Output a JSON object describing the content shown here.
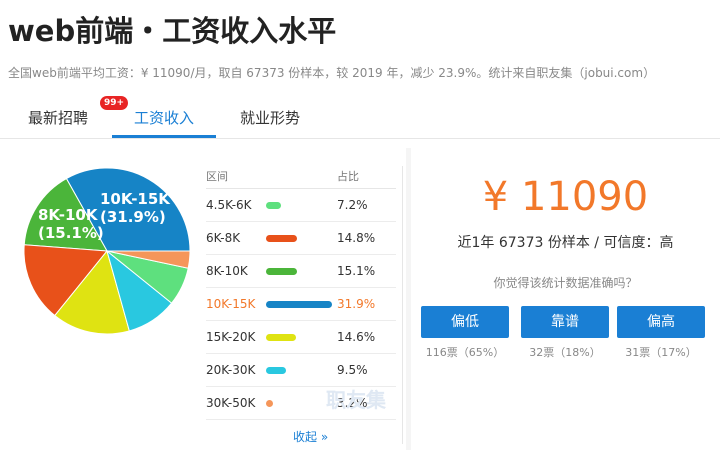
{
  "page": {
    "title": "web前端・工资收入水平",
    "subtitle": "全国web前端平均工资：¥ 11090/月，取自 67373 份样本，较 2019 年，减少 23.9%。统计来自职友集（jobui.com）"
  },
  "tabs": [
    {
      "label": "最新招聘",
      "badge": "99+"
    },
    {
      "label": "工资收入"
    },
    {
      "label": "就业形势"
    }
  ],
  "table": {
    "col_range": "区间",
    "col_ratio": "占比",
    "collapse": "收起 »",
    "watermark": "职友集"
  },
  "chart_data": {
    "type": "pie",
    "categories": [
      "4.5K-6K",
      "6K-8K",
      "8K-10K",
      "10K-15K",
      "15K-20K",
      "20K-30K",
      "30K-50K"
    ],
    "values": [
      7.2,
      14.8,
      15.1,
      31.9,
      14.6,
      9.5,
      3.2
    ],
    "value_labels": [
      "7.2%",
      "14.8%",
      "15.1%",
      "31.9%",
      "14.6%",
      "9.5%",
      "3.2%"
    ],
    "colors": [
      "#5ee07e",
      "#e8511a",
      "#4bb53a",
      "#1684c6",
      "#dfe312",
      "#29c8e0",
      "#f5965a"
    ],
    "slice_labels": [
      {
        "index": 3,
        "line1": "10K-15K",
        "line2": "(31.9%)"
      },
      {
        "index": 2,
        "line1": "8K-10K",
        "line2": "(15.1%)"
      }
    ],
    "highlight_index": 3
  },
  "summary": {
    "salary": "¥ 11090",
    "sample": "近1年 67373 份样本 / 可信度：高",
    "question": "你觉得该统计数据准确吗？",
    "votes": [
      {
        "label": "偏低",
        "count": "116票（65%）"
      },
      {
        "label": "靠谱",
        "count": "32票（18%）"
      },
      {
        "label": "偏高",
        "count": "31票（17%）"
      }
    ]
  },
  "colors": {
    "accent": "#1a7fd4",
    "highlight": "#f2782a",
    "badge": "#e82424"
  }
}
